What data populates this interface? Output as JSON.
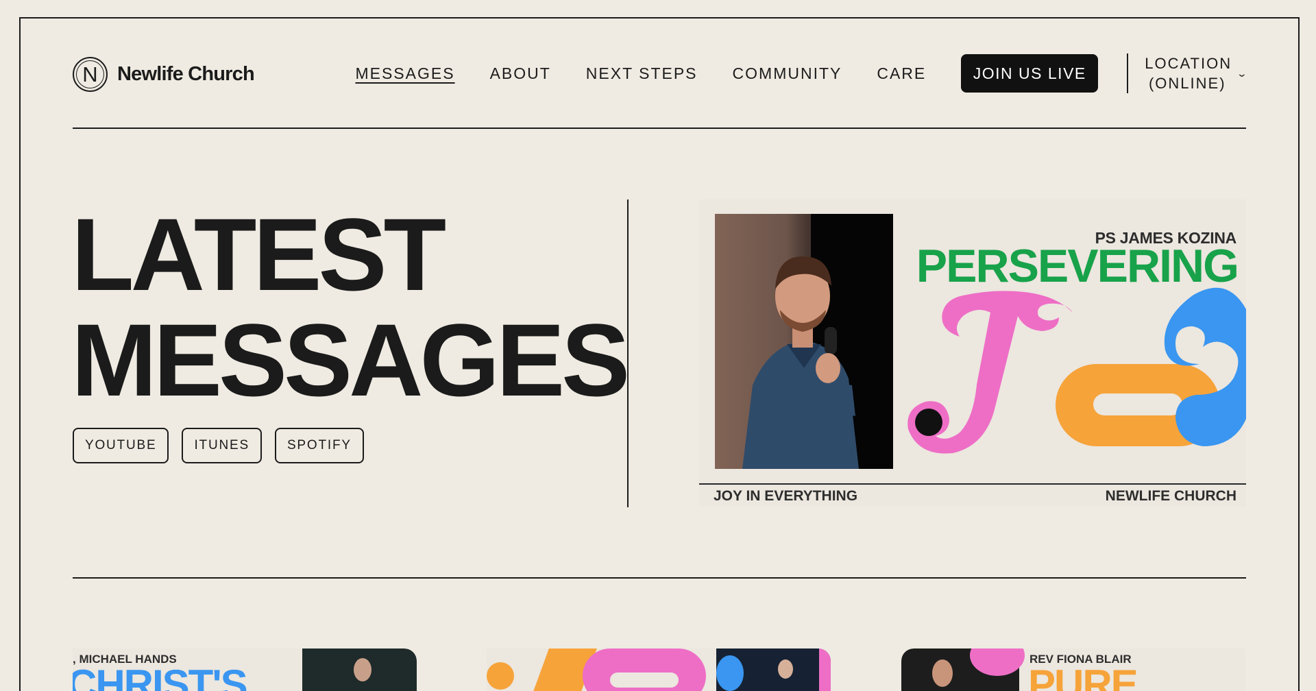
{
  "brand": {
    "logo_letter": "N",
    "name": "Newlife Church"
  },
  "nav": {
    "items": [
      {
        "label": "MESSAGES",
        "active": true
      },
      {
        "label": "ABOUT"
      },
      {
        "label": "NEXT STEPS"
      },
      {
        "label": "COMMUNITY"
      },
      {
        "label": "CARE"
      }
    ],
    "cta_label": "JOIN US LIVE",
    "location_label": "LOCATION (ONLINE)",
    "location_line1": "LOCATION",
    "location_line2": "(ONLINE)"
  },
  "hero": {
    "heading_line1": "LATEST",
    "heading_line2": "MESSAGES",
    "platforms": [
      "YOUTUBE",
      "ITUNES",
      "SPOTIFY"
    ]
  },
  "featured": {
    "speaker": "PS JAMES KOZINA",
    "title": "PERSEVERING",
    "artwork_word": "Joy",
    "series": "JOY IN EVERYTHING",
    "church": "NEWLIFE CHURCH"
  },
  "cards": [
    {
      "speaker": ", MICHAEL HANDS",
      "title": "CHRIST'S",
      "title_color": "#3a96f0"
    },
    {
      "speaker": "",
      "title": "",
      "title_color": "#f26bc4"
    },
    {
      "speaker": "REV FIONA BLAIR",
      "title": "PURE",
      "title_color": "#f6a33a"
    }
  ],
  "colors": {
    "background": "#efebe2",
    "ink": "#1b1b1b",
    "green": "#18a24a",
    "pink": "#ee6ec6",
    "orange": "#f6a33a",
    "blue": "#3a96f0"
  }
}
